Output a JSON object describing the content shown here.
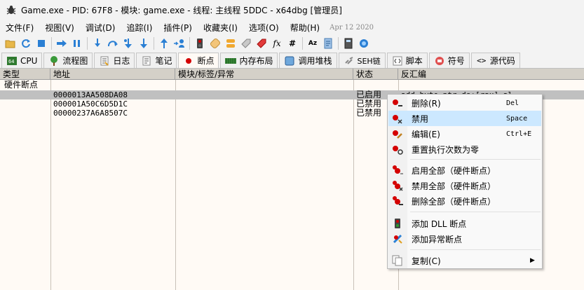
{
  "window": {
    "title": "Game.exe - PID: 67F8 - 模块: game.exe - 线程: 主线程 5DDC - x64dbg [管理员]"
  },
  "menu": {
    "items": [
      "文件(F)",
      "视图(V)",
      "调试(D)",
      "追踪(I)",
      "插件(P)",
      "收藏夹(I)",
      "选项(O)",
      "帮助(H)"
    ],
    "date": "Apr 12 2020"
  },
  "toolbar": {
    "icons": [
      "open-icon",
      "restart-icon",
      "stop-icon",
      "run-icon",
      "pause-icon",
      "step-into-icon",
      "step-over-icon",
      "trace-into-icon",
      "trace-over-icon",
      "run-to-user-icon",
      "animate-icon",
      "scylla-icon",
      "patch-icon",
      "comment-icon",
      "label-icon",
      "bookmark-icon",
      "function-icon",
      "hash-icon",
      "font-icon",
      "script-icon",
      "calculator-icon",
      "help-icon"
    ],
    "fx_label": "fx",
    "hash_label": "#",
    "font_label": "Az"
  },
  "tabs": [
    {
      "label": "CPU",
      "icon": "cpu-icon",
      "active": false
    },
    {
      "label": "流程图",
      "icon": "graph-icon",
      "active": false
    },
    {
      "label": "日志",
      "icon": "log-icon",
      "active": false
    },
    {
      "label": "笔记",
      "icon": "notes-icon",
      "active": false
    },
    {
      "label": "断点",
      "icon": "breakpoint-icon",
      "active": true
    },
    {
      "label": "内存布局",
      "icon": "memory-map-icon",
      "active": false
    },
    {
      "label": "调用堆栈",
      "icon": "call-stack-icon",
      "active": false
    },
    {
      "label": "SEH链",
      "icon": "seh-icon",
      "active": false
    },
    {
      "label": "脚本",
      "icon": "script-icon",
      "active": false
    },
    {
      "label": "符号",
      "icon": "symbols-icon",
      "active": false
    },
    {
      "label": "源代码",
      "icon": "source-icon",
      "active": false
    }
  ],
  "table": {
    "columns": [
      "类型",
      "地址",
      "模块/标签/异常",
      "状态",
      "反汇编"
    ],
    "group": "硬件断点",
    "rows": [
      {
        "address": "0000013AA508DA08",
        "status": "已启用",
        "disasm": "add byte ptr ds:[rax],al",
        "selected": true
      },
      {
        "address": "000001A50C6D5D1C",
        "status": "已禁用",
        "disasm": "",
        "selected": false
      },
      {
        "address": "00000237A6A8507C",
        "status": "已禁用",
        "disasm": "",
        "selected": false
      }
    ]
  },
  "context_menu": {
    "items": [
      {
        "label": "删除(R)",
        "shortcut": "Del",
        "icon": "delete-bp-icon"
      },
      {
        "label": "禁用",
        "shortcut": "Space",
        "icon": "disable-bp-icon",
        "highlighted": true
      },
      {
        "label": "编辑(E)",
        "shortcut": "Ctrl+E",
        "icon": "edit-bp-icon"
      },
      {
        "label": "重置执行次数为零",
        "shortcut": "",
        "icon": "reset-hit-icon"
      },
      {
        "label": "启用全部（硬件断点）",
        "shortcut": "",
        "icon": "enable-all-icon"
      },
      {
        "label": "禁用全部（硬件断点）",
        "shortcut": "",
        "icon": "disable-all-icon"
      },
      {
        "label": "删除全部（硬件断点）",
        "shortcut": "",
        "icon": "delete-all-icon"
      },
      {
        "label": "添加 DLL 断点",
        "shortcut": "",
        "icon": "dll-bp-icon"
      },
      {
        "label": "添加异常断点",
        "shortcut": "",
        "icon": "exception-bp-icon"
      },
      {
        "label": "复制(C)",
        "shortcut": "",
        "icon": "copy-icon",
        "submenu": true
      }
    ]
  },
  "colors": {
    "accent": "#cce8ff",
    "bp_red": "#d40000",
    "selection": "#c0c0c0"
  }
}
